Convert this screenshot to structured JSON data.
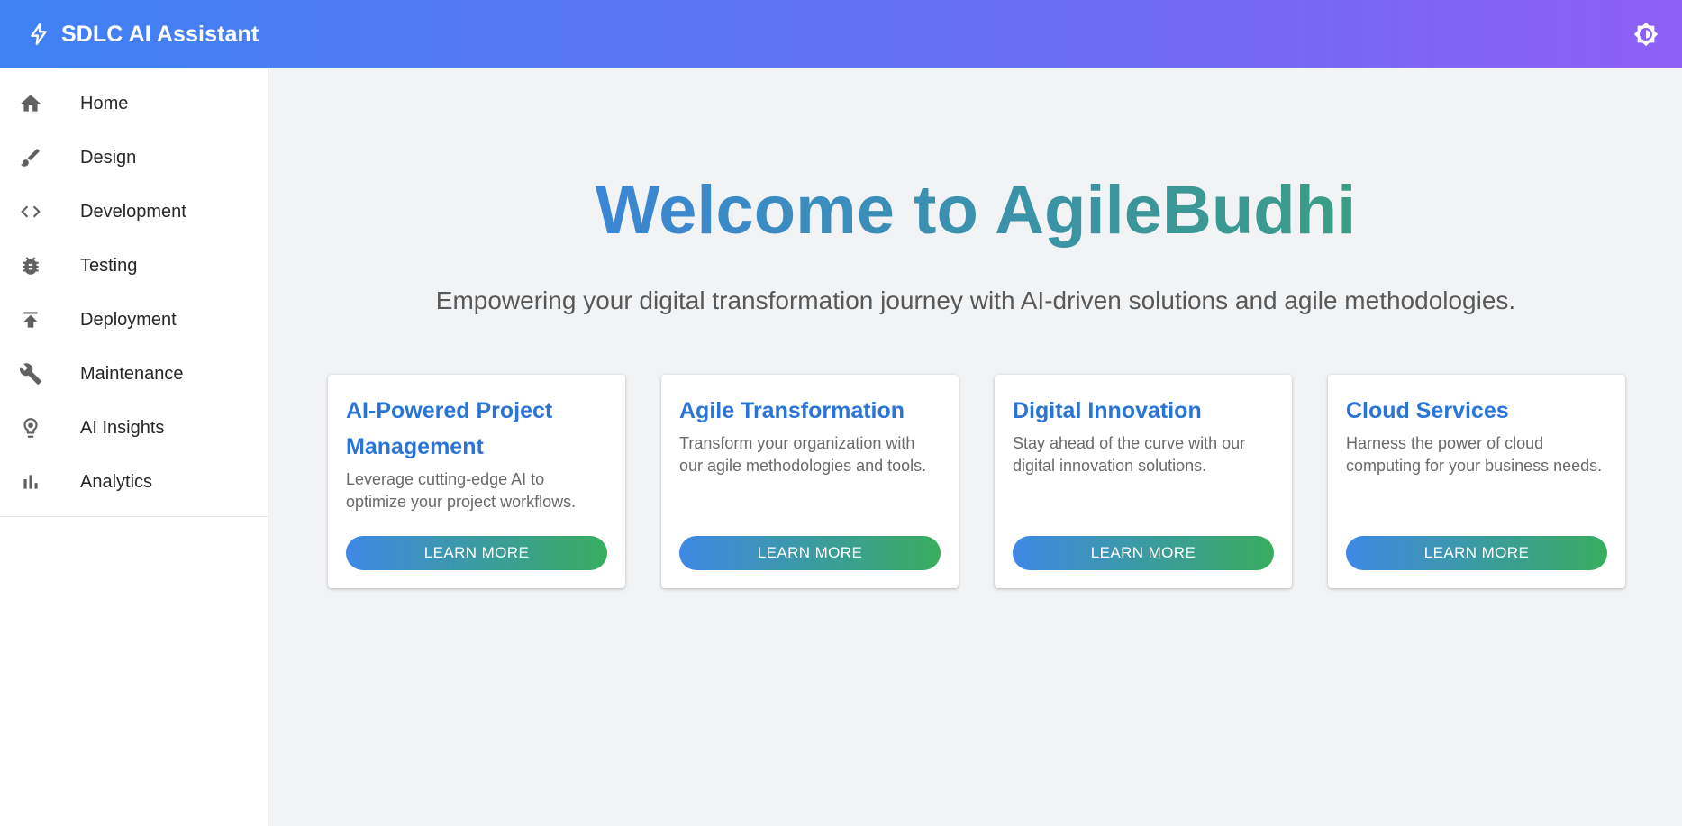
{
  "appbar": {
    "title": "SDLC AI Assistant",
    "icon": "bolt-icon",
    "theme_toggle_icon": "brightness-icon"
  },
  "sidebar": {
    "items": [
      {
        "label": "Home",
        "icon": "home-icon"
      },
      {
        "label": "Design",
        "icon": "brush-icon"
      },
      {
        "label": "Development",
        "icon": "code-icon"
      },
      {
        "label": "Testing",
        "icon": "bug-icon"
      },
      {
        "label": "Deployment",
        "icon": "publish-icon"
      },
      {
        "label": "Maintenance",
        "icon": "wrench-icon"
      },
      {
        "label": "AI Insights",
        "icon": "lightbulb-icon"
      },
      {
        "label": "Analytics",
        "icon": "bar-chart-icon"
      }
    ]
  },
  "hero": {
    "title": "Welcome to AgileBudhi",
    "subtitle": "Empowering your digital transformation journey with AI-driven solutions and agile methodologies."
  },
  "cards": [
    {
      "title": "AI-Powered Project Management",
      "description": "Leverage cutting-edge AI to optimize your project workflows.",
      "button": "LEARN MORE"
    },
    {
      "title": "Agile Transformation",
      "description": "Transform your organization with our agile methodologies and tools.",
      "button": "LEARN MORE"
    },
    {
      "title": "Digital Innovation",
      "description": "Stay ahead of the curve with our digital innovation solutions.",
      "button": "LEARN MORE"
    },
    {
      "title": "Cloud Services",
      "description": "Harness the power of cloud computing for your business needs.",
      "button": "LEARN MORE"
    }
  ],
  "colors": {
    "appbar_start": "#3f82f4",
    "appbar_end": "#8d5ff5",
    "card_title": "#2a74d6",
    "button_start": "#3f88e6",
    "button_end": "#38ad5e"
  }
}
